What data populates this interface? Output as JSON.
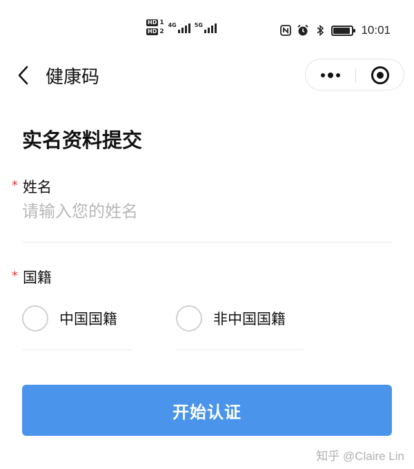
{
  "status_bar": {
    "sim1": {
      "badge": "HD",
      "num": "1",
      "network": "4G"
    },
    "sim2": {
      "badge": "HD",
      "num": "2",
      "network": "5G"
    },
    "icons": [
      "nfc-icon",
      "alarm-icon",
      "bluetooth-icon",
      "battery-icon"
    ],
    "battery_level": 0.9,
    "time": "10:01"
  },
  "nav": {
    "title": "健康码",
    "icons": {
      "back": "back-chevron-icon",
      "more": "more-dots-icon",
      "close": "miniprogram-close-icon"
    }
  },
  "form": {
    "heading": "实名资料提交",
    "required_mark": "*",
    "name": {
      "label": "姓名",
      "placeholder": "请输入您的姓名",
      "value": ""
    },
    "nationality": {
      "label": "国籍",
      "options": [
        "中国国籍",
        "非中国国籍"
      ],
      "selected": null
    },
    "submit_label": "开始认证"
  },
  "watermark": "知乎 @Claire Lin",
  "colors": {
    "primary_button": "#4a94ec",
    "required": "#e53935",
    "placeholder": "#b8b8b8"
  }
}
